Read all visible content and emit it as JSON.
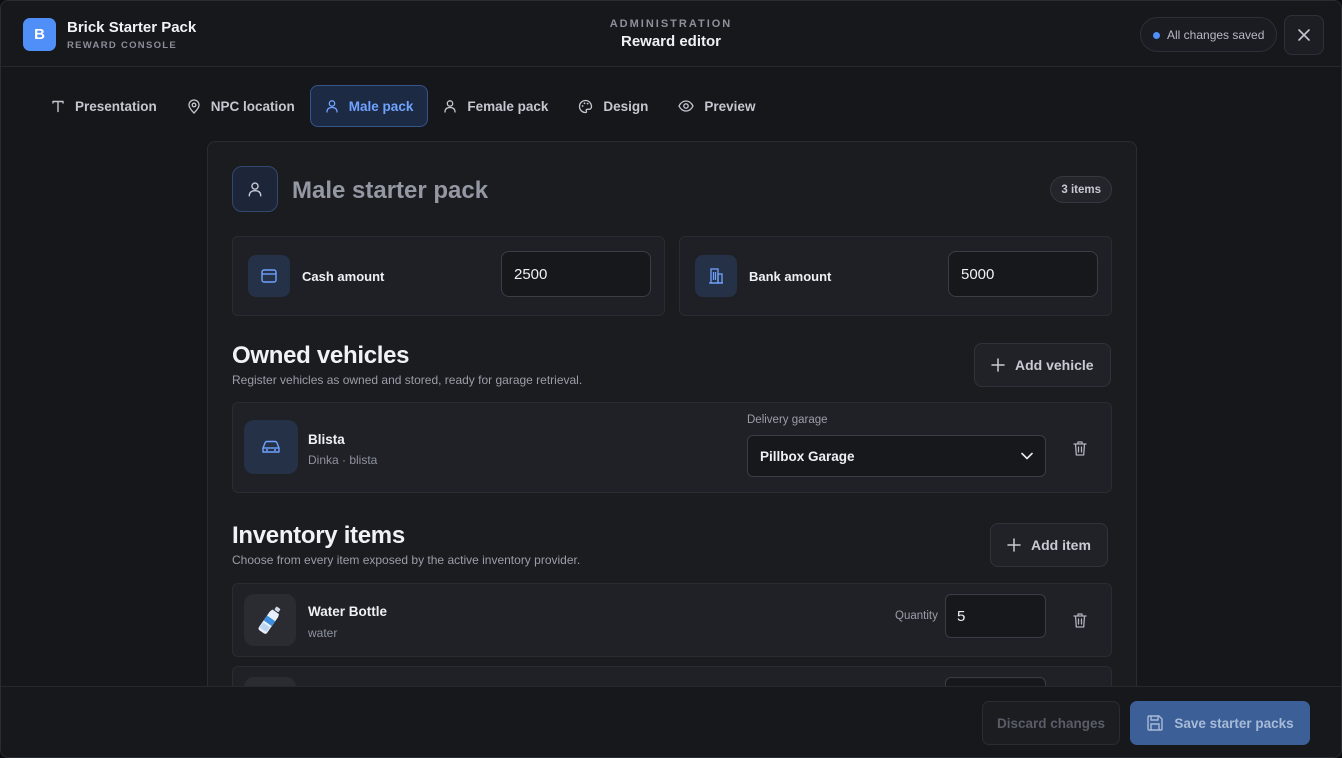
{
  "app": {
    "logo_letter": "B",
    "name": "Brick Starter Pack",
    "subtitle": "REWARD CONSOLE"
  },
  "header": {
    "kicker": "ADMINISTRATION",
    "title": "Reward editor",
    "status": "All changes saved",
    "status_color": "#4f8ff7"
  },
  "tabs": [
    {
      "label": "Presentation",
      "icon": "text-icon",
      "active": false
    },
    {
      "label": "NPC location",
      "icon": "map-pin-icon",
      "active": false
    },
    {
      "label": "Male pack",
      "icon": "user-icon",
      "active": true
    },
    {
      "label": "Female pack",
      "icon": "user-icon",
      "active": false
    },
    {
      "label": "Design",
      "icon": "palette-icon",
      "active": false
    },
    {
      "label": "Preview",
      "icon": "eye-icon",
      "active": false
    }
  ],
  "pack": {
    "title": "Male starter pack",
    "item_count": "3 items",
    "cash": {
      "label": "Cash amount",
      "value": "2500",
      "icon": "wallet-icon"
    },
    "bank": {
      "label": "Bank amount",
      "value": "5000",
      "icon": "bank-icon"
    }
  },
  "vehicles": {
    "title": "Owned vehicles",
    "description": "Register vehicles as owned and stored, ready for garage retrieval.",
    "add_label": "Add vehicle",
    "items": [
      {
        "name": "Blista",
        "detail": "Dinka · blista",
        "garage_label": "Delivery garage",
        "garage": "Pillbox Garage"
      }
    ]
  },
  "inventory": {
    "title": "Inventory items",
    "description": "Choose from every item exposed by the active inventory provider.",
    "add_label": "Add item",
    "items": [
      {
        "name": "Water Bottle",
        "code": "water",
        "quantity_label": "Quantity",
        "quantity": "5"
      }
    ]
  },
  "footer": {
    "discard_label": "Discard changes",
    "save_label": "Save starter packs"
  },
  "colors": {
    "accent": "#4f8ff7",
    "background": "#16171b",
    "panel": "#1b1c20"
  }
}
